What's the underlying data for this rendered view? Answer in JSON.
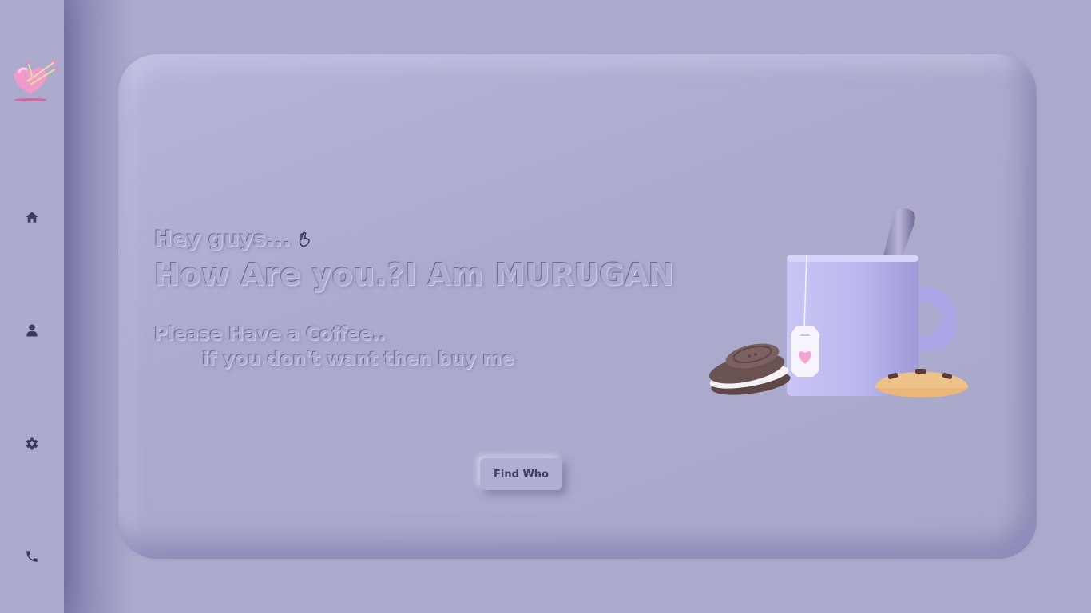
{
  "sidebar": {
    "logo_icon": "heart-with-arrows-icon",
    "items": [
      {
        "name": "home",
        "icon": "home-icon"
      },
      {
        "name": "profile",
        "icon": "user-icon"
      },
      {
        "name": "settings",
        "icon": "gear-icon"
      },
      {
        "name": "contact",
        "icon": "phone-icon"
      }
    ]
  },
  "hero": {
    "greeting": "Hey guys...",
    "greeting_icon": "peace-hand-icon",
    "headline": "How Are you.?I Am MURUGAN",
    "line1": "Please Have a Coffee..",
    "line2": "if you don't want then buy me",
    "cta_label": "Find Who",
    "illustration": "coffee-mug-with-cookies-illustration"
  },
  "colors": {
    "background": "#acabcd",
    "text_dark": "#3d3a63",
    "mug": "#bcb8ee",
    "heart": "#f4a3cf"
  }
}
